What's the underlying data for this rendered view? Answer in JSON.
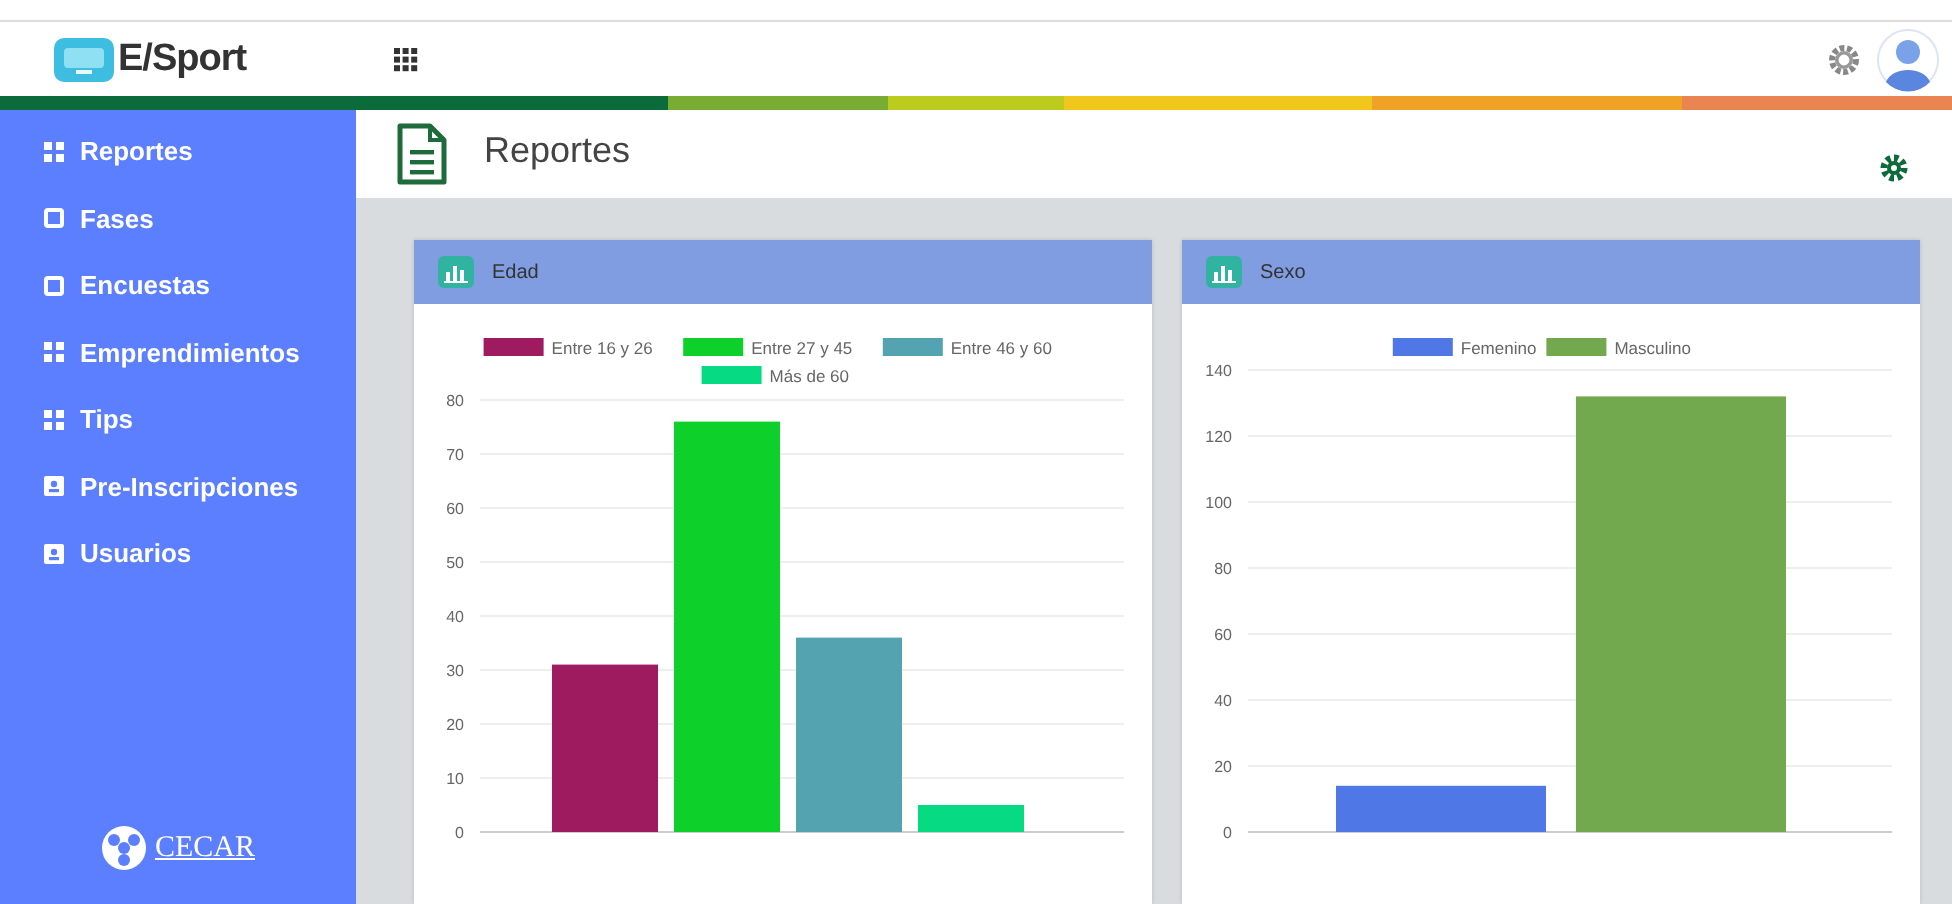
{
  "header": {
    "brand": "E/Sport"
  },
  "sidebar": {
    "items": [
      {
        "label": "Reportes",
        "kind": "grid"
      },
      {
        "label": "Fases",
        "kind": "square"
      },
      {
        "label": "Encuestas",
        "kind": "square"
      },
      {
        "label": "Emprendimientos",
        "kind": "grid"
      },
      {
        "label": "Tips",
        "kind": "grid"
      },
      {
        "label": "Pre-Inscripciones",
        "kind": "card"
      },
      {
        "label": "Usuarios",
        "kind": "card"
      }
    ],
    "logo_text": "CECAR"
  },
  "page": {
    "title": "Reportes"
  },
  "cards": [
    {
      "title": "Edad",
      "chart_data": {
        "type": "bar",
        "grid": true,
        "legend": "top",
        "ylim": [
          0,
          80
        ],
        "yticks": [
          0,
          10,
          20,
          30,
          40,
          50,
          60,
          70,
          80
        ],
        "series": [
          {
            "name": "Entre 16 y 26",
            "color": "#9e1b5f",
            "values": [
              31
            ]
          },
          {
            "name": "Entre 27 y 45",
            "color": "#0dd12a",
            "values": [
              76
            ]
          },
          {
            "name": "Entre 46 y 60",
            "color": "#53a3b0",
            "values": [
              36
            ]
          },
          {
            "name": "Más de 60",
            "color": "#06db84",
            "values": [
              5
            ]
          }
        ]
      }
    },
    {
      "title": "Sexo",
      "chart_data": {
        "type": "bar",
        "grid": true,
        "legend": "top",
        "ylim": [
          0,
          140
        ],
        "yticks": [
          0,
          20,
          40,
          60,
          80,
          100,
          120,
          140
        ],
        "series": [
          {
            "name": "Femenino",
            "color": "#4f78e6",
            "values": [
              14
            ]
          },
          {
            "name": "Masculino",
            "color": "#72a84e",
            "values": [
              132
            ]
          }
        ]
      }
    }
  ]
}
